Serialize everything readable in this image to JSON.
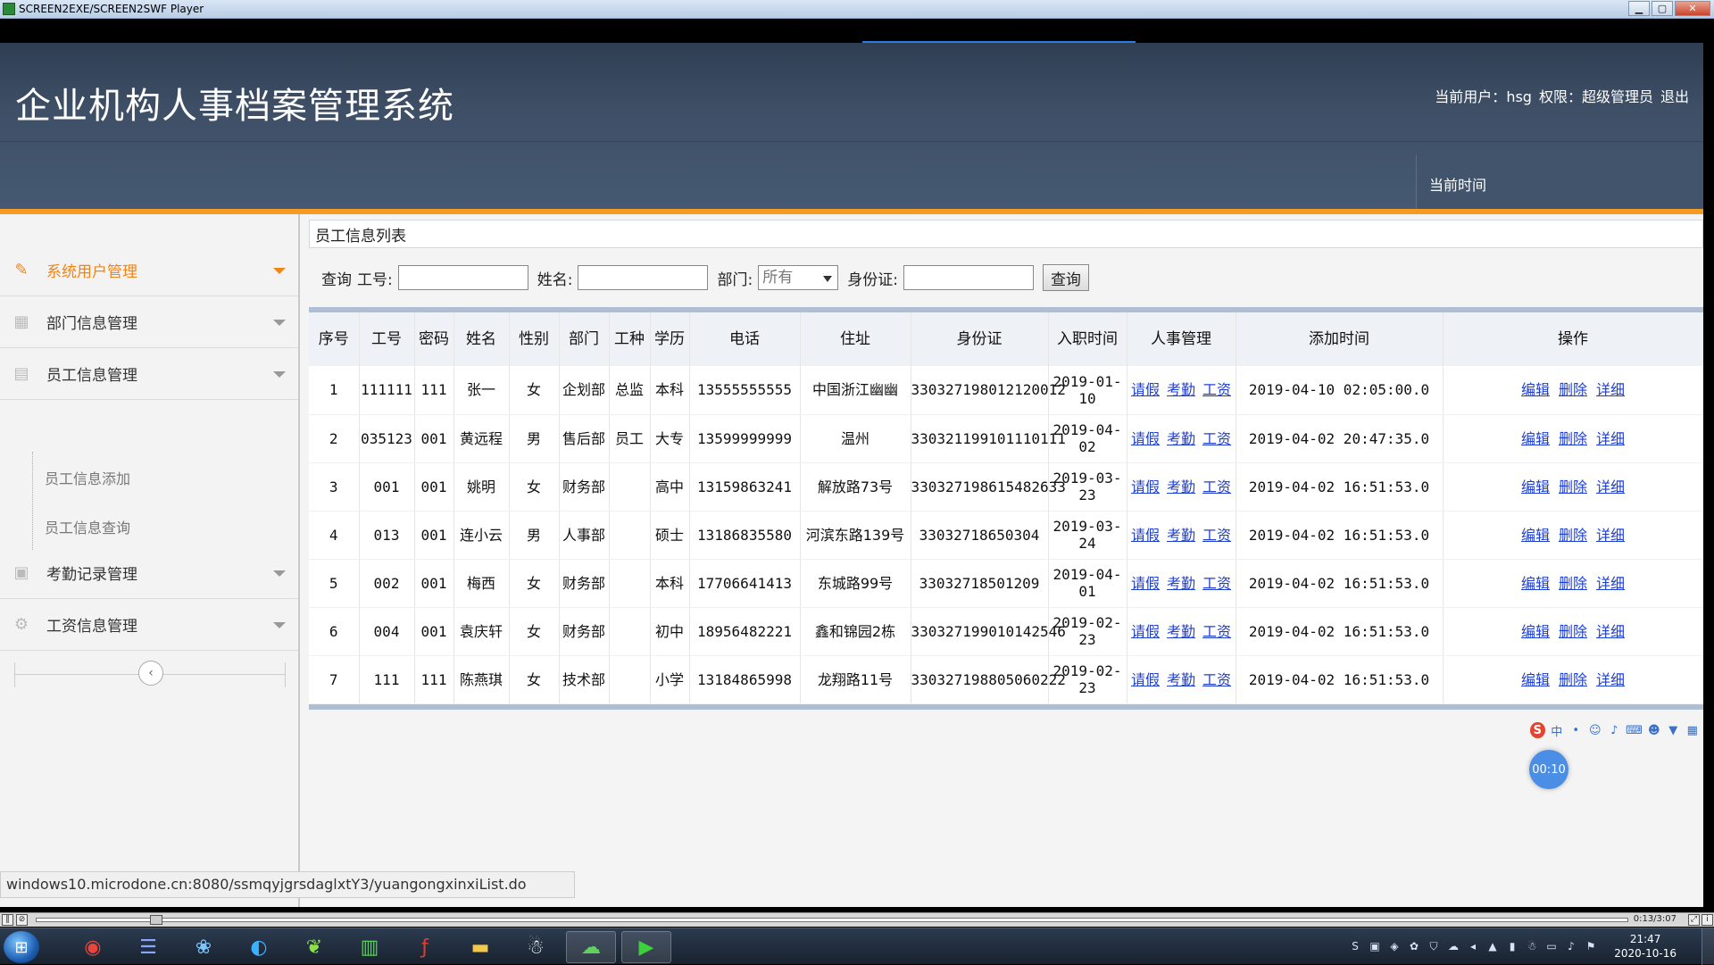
{
  "player": {
    "title": "SCREEN2EXE/SCREEN2SWF Player",
    "time": "0:13/3:07"
  },
  "header": {
    "system_title": "企业机构人事档案管理系统",
    "current_user_label": "当前用户：",
    "current_user": "hsg",
    "role_label": "权限：",
    "role": "超级管理员",
    "logout": "退出",
    "time_label": "当前时间"
  },
  "sidebar": {
    "items": [
      {
        "label": "系统用户管理",
        "icon": "pencil-icon"
      },
      {
        "label": "部门信息管理",
        "icon": "grid-icon"
      },
      {
        "label": "员工信息管理",
        "icon": "id-card-icon"
      },
      {
        "label": "考勤记录管理",
        "icon": "calendar-icon"
      },
      {
        "label": "工资信息管理",
        "icon": "settings-icon"
      }
    ],
    "sub_items": [
      "员工信息添加",
      "员工信息查询"
    ]
  },
  "main": {
    "panel_title": "员工信息列表",
    "search": {
      "query_label": "查询",
      "id_label": "工号:",
      "name_label": "姓名:",
      "dept_label": "部门:",
      "dept_value": "所有",
      "idcard_label": "身份证:",
      "button": "查询"
    },
    "columns": [
      "序号",
      "工号",
      "密码",
      "姓名",
      "性别",
      "部门",
      "工种",
      "学历",
      "电话",
      "住址",
      "身份证",
      "入职时间",
      "人事管理",
      "添加时间",
      "操作"
    ],
    "hr_links": [
      "请假",
      "考勤",
      "工资"
    ],
    "op_links": [
      "编辑",
      "删除",
      "详细"
    ],
    "rows": [
      {
        "no": "1",
        "id": "111111",
        "pwd": "111",
        "name": "张一",
        "sex": "女",
        "dept": "企划部",
        "job": "总监",
        "edu": "本科",
        "phone": "13555555555",
        "addr": "中国浙江幽幽",
        "idcard": "330327198012120012",
        "join": "2019-01-10",
        "added": "2019-04-10 02:05:00.0"
      },
      {
        "no": "2",
        "id": "035123",
        "pwd": "001",
        "name": "黄远程",
        "sex": "男",
        "dept": "售后部",
        "job": "员工",
        "edu": "大专",
        "phone": "13599999999",
        "addr": "温州",
        "idcard": "330321199101110111",
        "join": "2019-04-02",
        "added": "2019-04-02 20:47:35.0"
      },
      {
        "no": "3",
        "id": "001",
        "pwd": "001",
        "name": "姚明",
        "sex": "女",
        "dept": "财务部",
        "job": "",
        "edu": "高中",
        "phone": "13159863241",
        "addr": "解放路73号",
        "idcard": "330327198615482633",
        "join": "2019-03-23",
        "added": "2019-04-02 16:51:53.0"
      },
      {
        "no": "4",
        "id": "013",
        "pwd": "001",
        "name": "连小云",
        "sex": "男",
        "dept": "人事部",
        "job": "",
        "edu": "硕士",
        "phone": "13186835580",
        "addr": "河滨东路139号",
        "idcard": "33032718650304",
        "join": "2019-03-24",
        "added": "2019-04-02 16:51:53.0"
      },
      {
        "no": "5",
        "id": "002",
        "pwd": "001",
        "name": "梅西",
        "sex": "女",
        "dept": "财务部",
        "job": "",
        "edu": "本科",
        "phone": "17706641413",
        "addr": "东城路99号",
        "idcard": "33032718501209",
        "join": "2019-04-01",
        "added": "2019-04-02 16:51:53.0"
      },
      {
        "no": "6",
        "id": "004",
        "pwd": "001",
        "name": "袁庆轩",
        "sex": "女",
        "dept": "财务部",
        "job": "",
        "edu": "初中",
        "phone": "18956482221",
        "addr": "鑫和锦园2栋",
        "idcard": "330327199010142546",
        "join": "2019-02-23",
        "added": "2019-04-02 16:51:53.0"
      },
      {
        "no": "7",
        "id": "111",
        "pwd": "111",
        "name": "陈燕琪",
        "sex": "女",
        "dept": "技术部",
        "job": "",
        "edu": "小学",
        "phone": "13184865998",
        "addr": "龙翔路11号",
        "idcard": "330327198805060222",
        "join": "2019-02-23",
        "added": "2019-04-02 16:51:53.0"
      }
    ]
  },
  "status_url": "windows10.microdone.cn:8080/ssmqyjgrsdaglxtY3/yuangongxinxiList.do",
  "timer_bubble": "00:10",
  "clock": {
    "time": "21:47",
    "date": "2020-10-16"
  },
  "colors": {
    "header": "#3e4f66",
    "accent": "#f59a23",
    "active_menu": "#f0861a",
    "link": "#1f3fd0"
  }
}
